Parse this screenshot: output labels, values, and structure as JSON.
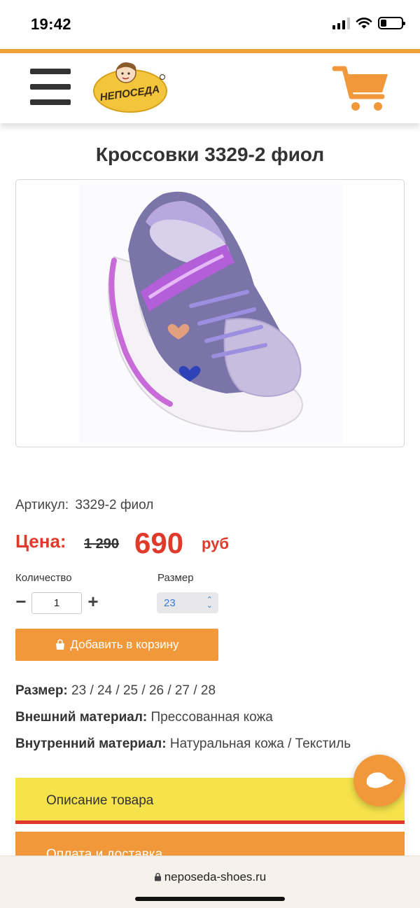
{
  "status_bar": {
    "time": "19:42"
  },
  "header": {
    "logo_text": "НЕПОСЕДА",
    "accent_color": "#f0a03a"
  },
  "product": {
    "title": "Кроссовки 3329-2 фиол",
    "image_alt": "Кроссовки 3329-2 фиол",
    "sku_label": "Артикул:",
    "sku_value": "3329-2 фиол",
    "price_label": "Цена:",
    "old_price": "1 290",
    "new_price": "690",
    "currency": "руб",
    "quantity_label": "Количество",
    "quantity_value": "1",
    "size_label": "Размер",
    "size_selected": "23",
    "add_to_cart": "Добавить в корзину"
  },
  "specs": [
    {
      "label": "Размер:",
      "value": "23 / 24 / 25 / 26 / 27 / 28"
    },
    {
      "label": "Внешний материал:",
      "value": "Прессованная кожа"
    },
    {
      "label": "Внутренний материал:",
      "value": "Натуральная кожа / Текстиль"
    }
  ],
  "accordion": {
    "description": "Описание товара",
    "delivery": "Оплата и доставка"
  },
  "browser": {
    "url": "neposeda-shoes.ru"
  },
  "colors": {
    "orange": "#f0983a",
    "red": "#e03a2a",
    "yellow": "#f6e24a"
  }
}
